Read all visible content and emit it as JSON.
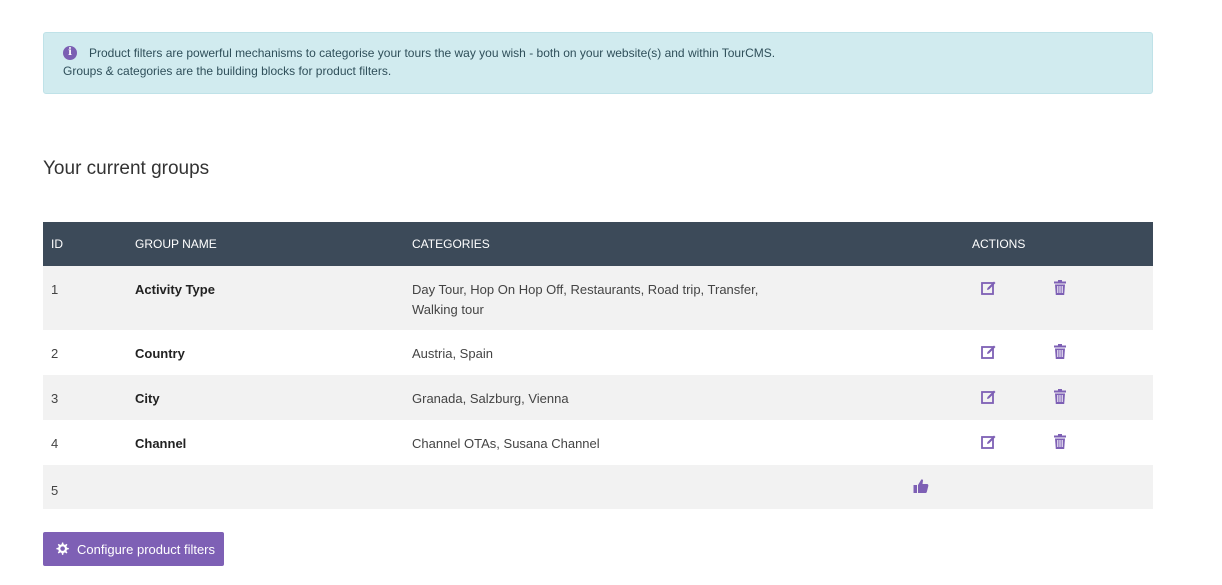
{
  "info": {
    "line1": "Product filters are powerful mechanisms to categorise your tours the way you wish - both on your website(s) and within TourCMS.",
    "line2": "Groups & categories are the building blocks for product filters.",
    "icon": "info-icon"
  },
  "section_title": "Your current groups",
  "table": {
    "headers": {
      "id": "ID",
      "group_name": "GROUP NAME",
      "categories": "CATEGORIES",
      "actions": "ACTIONS"
    },
    "rows": [
      {
        "id": "1",
        "name": "Activity Type",
        "categories": "Day Tour, Hop On Hop Off, Restaurants, Road trip, Transfer, Walking tour"
      },
      {
        "id": "2",
        "name": "Country",
        "categories": "Austria, Spain"
      },
      {
        "id": "3",
        "name": "City",
        "categories": "Granada, Salzburg, Vienna"
      },
      {
        "id": "4",
        "name": "Channel",
        "categories": "Channel OTAs, Susana Channel"
      },
      {
        "id": "5",
        "name": "",
        "categories": ""
      }
    ]
  },
  "configure_button": {
    "label": "Configure product filters",
    "icon": "gear-icon"
  },
  "colors": {
    "accent": "#7e60b5",
    "header_bg": "#3c4a59",
    "info_bg": "#d1ebef"
  }
}
